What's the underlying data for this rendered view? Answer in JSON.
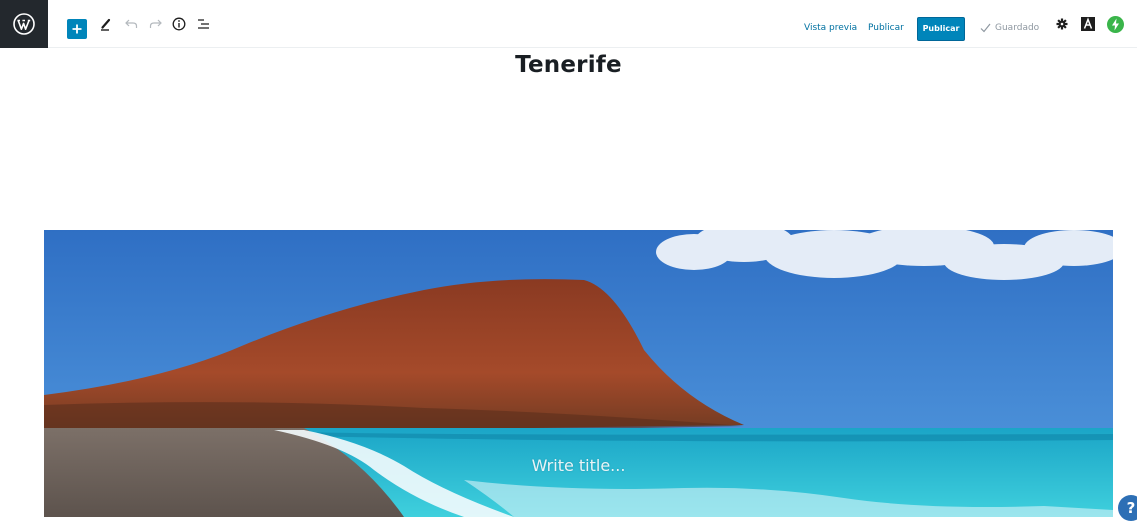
{
  "toolbar": {
    "logo_icon": "wordpress-logo-icon",
    "add_icon": "plus-icon",
    "tools_icon": "pencil-icon",
    "undo_icon": "undo-icon",
    "redo_icon": "redo-icon",
    "info_icon": "info-icon",
    "outline_icon": "list-view-icon",
    "preview_label": "Vista previa",
    "publish_secondary_label": "Publicar",
    "publish_primary_label": "Publicar",
    "saved_label": "Guardado",
    "settings_icon": "gear-icon",
    "font_icon": "letter-a-icon",
    "plugin_icon": "lightning-icon"
  },
  "post": {
    "title": "Tenerife"
  },
  "cover": {
    "placeholder": "Write title..."
  },
  "help": {
    "label": "?"
  },
  "colors": {
    "accent": "#0085ba",
    "admin_dark": "#23282d",
    "plugin_green": "#3ab54a"
  }
}
